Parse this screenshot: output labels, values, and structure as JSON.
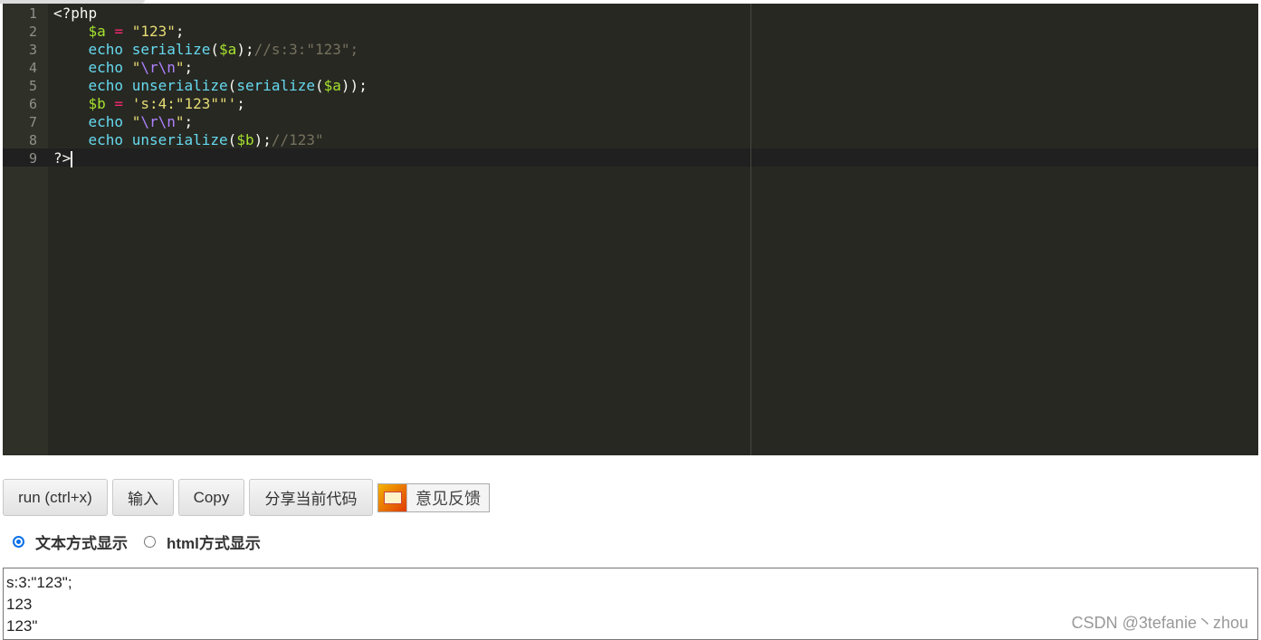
{
  "editor": {
    "lines": [
      {
        "n": "1",
        "tokens": [
          {
            "t": "<?php",
            "c": "pl"
          }
        ]
      },
      {
        "n": "2",
        "tokens": [
          {
            "t": "    ",
            "c": "pl"
          },
          {
            "t": "$a",
            "c": "var"
          },
          {
            "t": " = ",
            "c": "op"
          },
          {
            "t": "\"123\"",
            "c": "str"
          },
          {
            "t": ";",
            "c": "pl"
          }
        ]
      },
      {
        "n": "3",
        "tokens": [
          {
            "t": "    ",
            "c": "pl"
          },
          {
            "t": "echo",
            "c": "kw"
          },
          {
            "t": " ",
            "c": "pl"
          },
          {
            "t": "serialize",
            "c": "fn"
          },
          {
            "t": "(",
            "c": "pl"
          },
          {
            "t": "$a",
            "c": "var"
          },
          {
            "t": ");",
            "c": "pl"
          },
          {
            "t": "//s:3:\"123\";",
            "c": "cm"
          }
        ]
      },
      {
        "n": "4",
        "tokens": [
          {
            "t": "    ",
            "c": "pl"
          },
          {
            "t": "echo",
            "c": "kw"
          },
          {
            "t": " ",
            "c": "pl"
          },
          {
            "t": "\"",
            "c": "str"
          },
          {
            "t": "\\r\\n",
            "c": "esc"
          },
          {
            "t": "\"",
            "c": "str"
          },
          {
            "t": ";",
            "c": "pl"
          }
        ]
      },
      {
        "n": "5",
        "tokens": [
          {
            "t": "    ",
            "c": "pl"
          },
          {
            "t": "echo",
            "c": "kw"
          },
          {
            "t": " ",
            "c": "pl"
          },
          {
            "t": "unserialize",
            "c": "fn"
          },
          {
            "t": "(",
            "c": "pl"
          },
          {
            "t": "serialize",
            "c": "fn"
          },
          {
            "t": "(",
            "c": "pl"
          },
          {
            "t": "$a",
            "c": "var"
          },
          {
            "t": "));",
            "c": "pl"
          }
        ]
      },
      {
        "n": "6",
        "tokens": [
          {
            "t": "    ",
            "c": "pl"
          },
          {
            "t": "$b",
            "c": "var"
          },
          {
            "t": " = ",
            "c": "op"
          },
          {
            "t": "'s:4:\"123\"\"'",
            "c": "str"
          },
          {
            "t": ";",
            "c": "pl"
          }
        ]
      },
      {
        "n": "7",
        "tokens": [
          {
            "t": "    ",
            "c": "pl"
          },
          {
            "t": "echo",
            "c": "kw"
          },
          {
            "t": " ",
            "c": "pl"
          },
          {
            "t": "\"",
            "c": "str"
          },
          {
            "t": "\\r\\n",
            "c": "esc"
          },
          {
            "t": "\"",
            "c": "str"
          },
          {
            "t": ";",
            "c": "pl"
          }
        ]
      },
      {
        "n": "8",
        "tokens": [
          {
            "t": "    ",
            "c": "pl"
          },
          {
            "t": "echo",
            "c": "kw"
          },
          {
            "t": " ",
            "c": "pl"
          },
          {
            "t": "unserialize",
            "c": "fn"
          },
          {
            "t": "(",
            "c": "pl"
          },
          {
            "t": "$b",
            "c": "var"
          },
          {
            "t": ");",
            "c": "pl"
          },
          {
            "t": "//123\"",
            "c": "cm"
          }
        ]
      },
      {
        "n": "9",
        "tokens": [
          {
            "t": "?>",
            "c": "pl"
          }
        ]
      }
    ]
  },
  "toolbar": {
    "run": "run (ctrl+x)",
    "input": "输入",
    "copy": "Copy",
    "share": "分享当前代码",
    "feedback": "意见反馈",
    "feedback_icon": "mail-icon"
  },
  "display_mode": {
    "options": [
      "文本方式显示",
      "html方式显示"
    ],
    "selected": "文本方式显示"
  },
  "output": {
    "lines": [
      "s:3:\"123\";",
      "123",
      "123\""
    ]
  },
  "watermark": "CSDN @3tefanie丶zhou",
  "colors": {
    "editor_bg": "#272822",
    "accent": "#0a70e8"
  }
}
